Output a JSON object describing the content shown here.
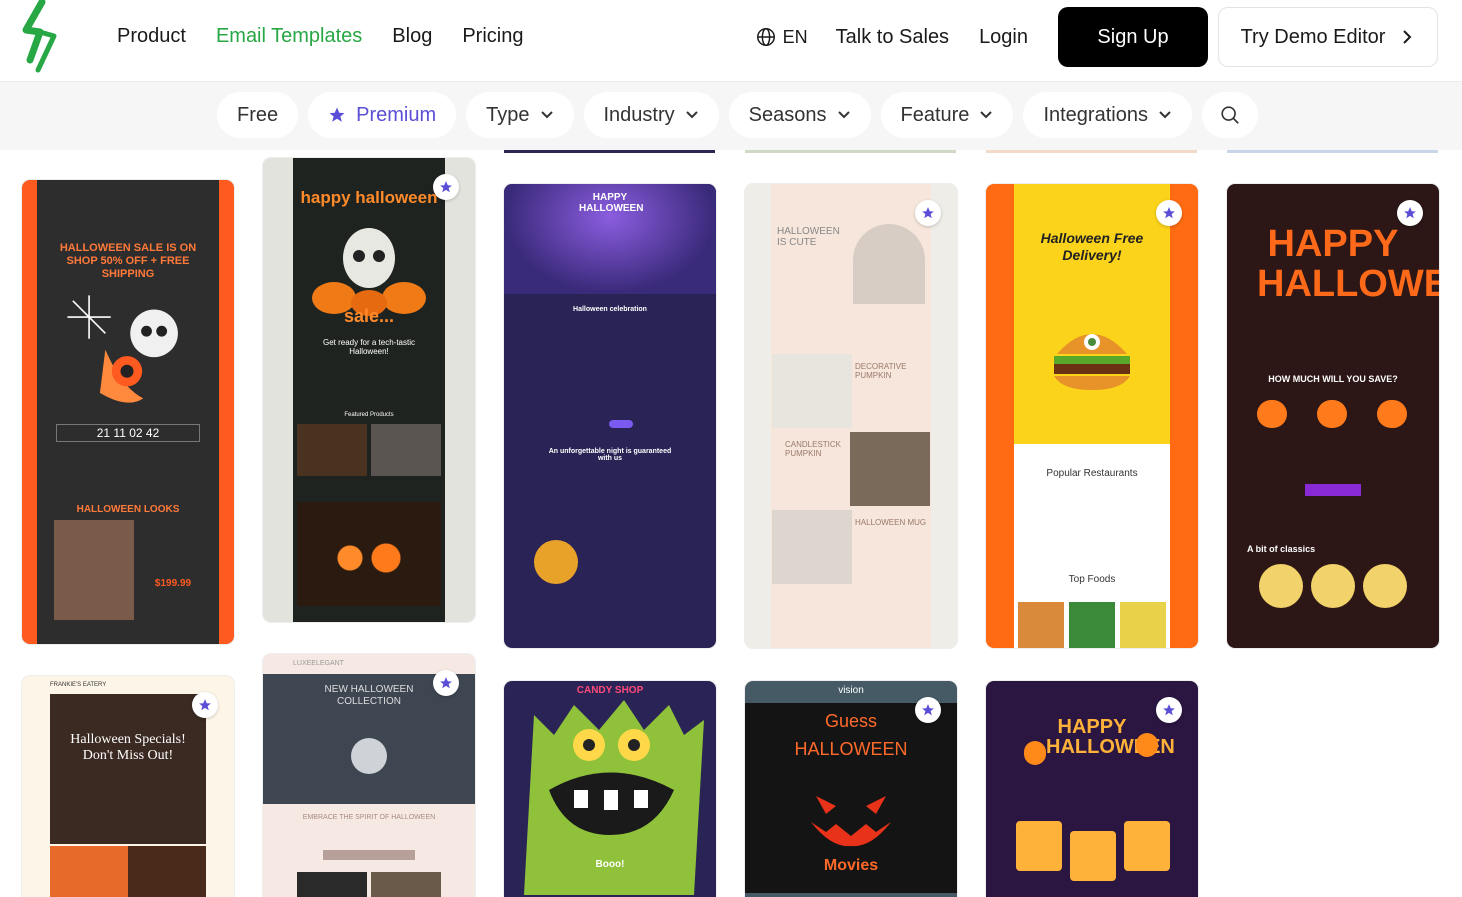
{
  "nav": {
    "items": [
      {
        "label": "Product",
        "active": false
      },
      {
        "label": "Email Templates",
        "active": true
      },
      {
        "label": "Blog",
        "active": false
      },
      {
        "label": "Pricing",
        "active": false
      }
    ]
  },
  "header": {
    "lang": "EN",
    "talk_to_sales": "Talk to Sales",
    "login": "Login",
    "signup": "Sign Up",
    "demo": "Try Demo Editor"
  },
  "filters": {
    "free": "Free",
    "premium": "Premium",
    "type": "Type",
    "industry": "Industry",
    "seasons": "Seasons",
    "feature": "Feature",
    "integrations": "Integrations"
  },
  "colors": {
    "accent_green": "#28a745",
    "premium_purple": "#5b4ed6",
    "halloween_orange": "#ff5a1f"
  },
  "cards": {
    "c1": {
      "title": "HALLOWEEN SALE IS ON SHOP 50% OFF + FREE SHIPPING",
      "sub": "HALLOWEEN LOOKS",
      "price": "$199.99",
      "countdown": "21  11  02  42"
    },
    "c2": {
      "title": "happy halloween",
      "sale": "sale...",
      "sub": "Get ready for a tech-tastic Halloween!",
      "sub2": "Featured Products"
    },
    "c3": {
      "title": "HAPPY HALLOWEEN",
      "sub": "Halloween celebration",
      "sub2": "An unforgettable night is guaranteed with us"
    },
    "c4": {
      "title": "HALLOWEEN IS CUTE",
      "item1": "DECORATIVE PUMPKIN",
      "item2": "CANDLESTICK PUMPKIN",
      "item3": "HALLOWEEN MUG"
    },
    "c5": {
      "title": "Halloween Free Delivery!",
      "sub": "Popular Restaurants",
      "sub2": "Top Foods"
    },
    "c6": {
      "title": "HAPPY HALLOWEEN",
      "sub": "HOW MUCH WILL YOU SAVE?",
      "sub2": "A bit of classics"
    },
    "c7": {
      "brand": "FRANKIE'S EATERY",
      "title": "Halloween Specials! Don't Miss Out!"
    },
    "c8": {
      "brand": "LUXEELEGANT",
      "title": "NEW HALLOWEEN COLLECTION",
      "sub": "EMBRACE THE SPIRIT OF HALLOWEEN"
    },
    "c9": {
      "brand": "CANDY SHOP",
      "sub": "Booo!"
    },
    "c10": {
      "brand": "vision",
      "title": "Guess HALLOWEEN",
      "sub": "Movies"
    },
    "c11": {
      "title": "HAPPY HALLOWEEN"
    }
  }
}
